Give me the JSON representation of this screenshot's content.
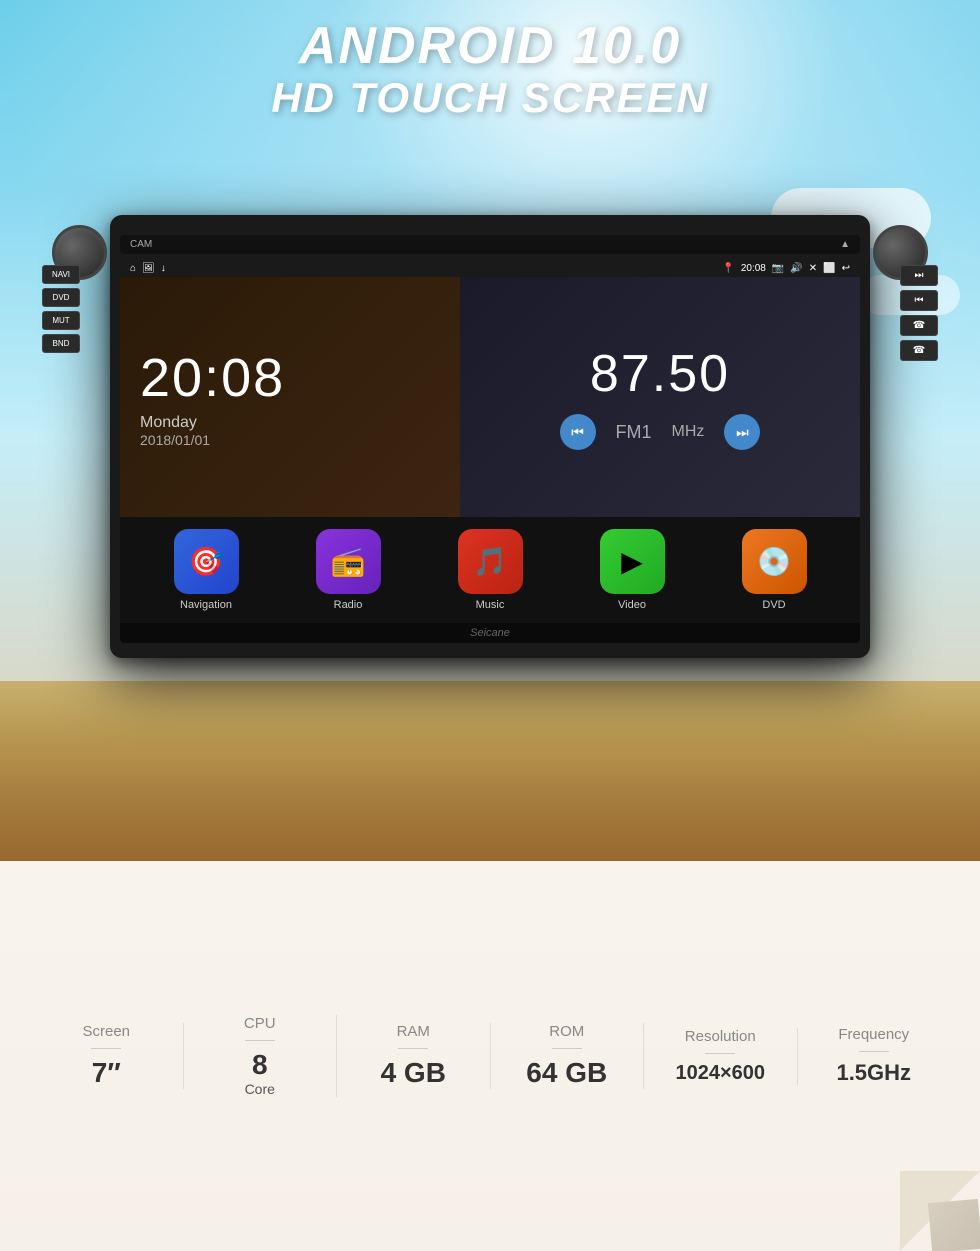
{
  "title": {
    "line1": "ANDROID 10.0",
    "line2": "HD TOUCH SCREEN"
  },
  "stereo": {
    "topbar": {
      "left": "CAM",
      "right": "▲"
    },
    "statusbar": {
      "home": "⌂",
      "icons_left": "🖼 ψ",
      "location": "📍",
      "time": "20:08",
      "camera": "📷",
      "volume": "🔊",
      "close": "✕",
      "screen": "⬜",
      "back": "↩"
    },
    "clock": {
      "time": "20:08",
      "day": "Monday",
      "date": "2018/01/01"
    },
    "radio": {
      "frequency": "87.50",
      "band": "FM1",
      "unit": "MHz"
    },
    "apps": [
      {
        "label": "Navigation",
        "icon": "🎯",
        "color_class": "nav-icon"
      },
      {
        "label": "Radio",
        "icon": "📻",
        "color_class": "radio-icon-bg"
      },
      {
        "label": "Music",
        "icon": "🎵",
        "color_class": "music-icon"
      },
      {
        "label": "Video",
        "icon": "▶",
        "color_class": "video-icon"
      },
      {
        "label": "DVD",
        "icon": "💿",
        "color_class": "dvd-icon"
      }
    ],
    "watermark": "Seicane",
    "side_buttons_left": [
      "NAVI",
      "DVD",
      "MUT",
      "BND"
    ],
    "side_buttons_right": [
      "⏭",
      "⏮",
      "📞",
      "📞"
    ]
  },
  "specs": [
    {
      "label": "Screen",
      "value": "7″",
      "sub": ""
    },
    {
      "label": "CPU",
      "value": "8",
      "sub": "Core"
    },
    {
      "label": "RAM",
      "value": "4 GB",
      "sub": ""
    },
    {
      "label": "ROM",
      "value": "64 GB",
      "sub": ""
    },
    {
      "label": "Resolution",
      "value": "1024×600",
      "sub": ""
    },
    {
      "label": "Frequency",
      "value": "1.5GHz",
      "sub": ""
    }
  ]
}
